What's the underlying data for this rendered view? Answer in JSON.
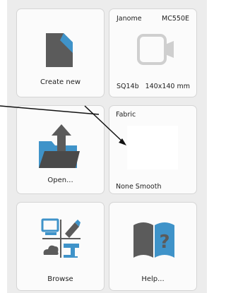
{
  "tiles": {
    "create_new": {
      "label": "Create new",
      "icon": "new-document-icon"
    },
    "machine": {
      "brand": "Janome",
      "model": "MC550E",
      "hoop": "SQ14b",
      "size": "140x140 mm",
      "icon": "hoop-frame-icon"
    },
    "open": {
      "label": "Open...",
      "icon": "open-folder-icon"
    },
    "fabric": {
      "title": "Fabric",
      "setting": "None Smooth"
    },
    "browse": {
      "label": "Browse",
      "icon": "browse-devices-icon"
    },
    "help": {
      "label": "Help...",
      "icon": "help-book-icon"
    }
  },
  "colors": {
    "accent_blue": "#3f93c9",
    "dark_gray": "#5b5b5b",
    "arrow_line": "#111111"
  }
}
